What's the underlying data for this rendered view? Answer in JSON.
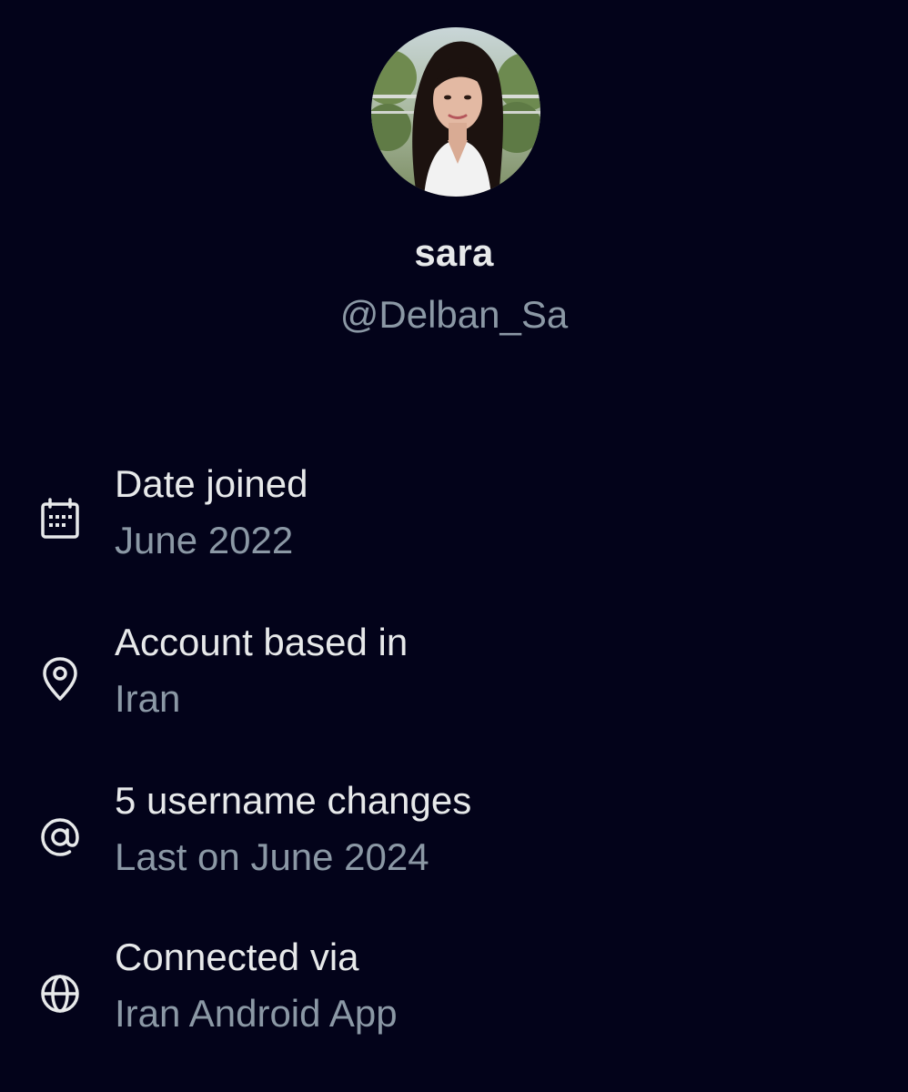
{
  "profile": {
    "display_name": "sara",
    "handle": "@Delban_Sa"
  },
  "about": {
    "items": [
      {
        "icon": "calendar-icon",
        "title": "Date joined",
        "value": "June 2022"
      },
      {
        "icon": "location-pin-icon",
        "title": "Account based in",
        "value": "Iran"
      },
      {
        "icon": "at-sign-icon",
        "title": "5 username changes",
        "value": "Last on June 2024"
      },
      {
        "icon": "globe-icon",
        "title": "Connected via",
        "value": "Iran Android App"
      }
    ]
  },
  "colors": {
    "background": "#03031a",
    "primary_text": "#e7e9ea",
    "secondary_text": "#8b98a5"
  }
}
